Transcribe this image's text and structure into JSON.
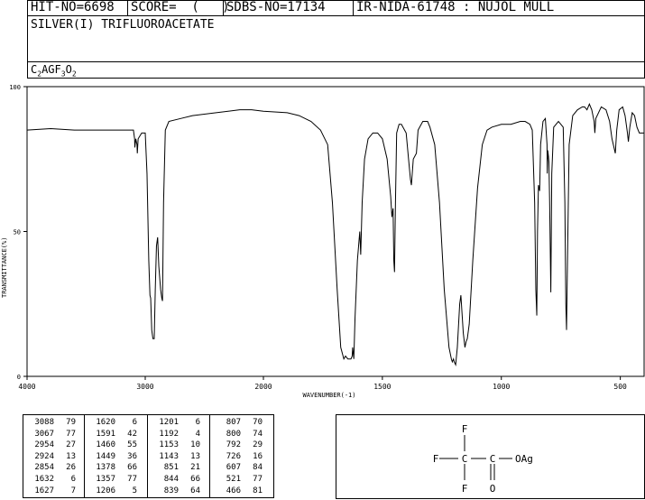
{
  "header": {
    "hit_no": "HIT-NO=6698",
    "score": "SCORE=  (   )",
    "sdbs_no": "SDBS-NO=17134",
    "ir_nida": "IR-NIDA-61748 : NUJOL MULL"
  },
  "compound": {
    "name": "SILVER(I) TRIFLUOROACETATE",
    "formula_parts": [
      "C",
      "2",
      "AGF",
      "3",
      "O",
      "2"
    ]
  },
  "chart_data": {
    "type": "line",
    "xlabel": "WAVENUMBER(-1)",
    "ylabel": "TRANSMITTANCE(%)",
    "xlim": [
      4000,
      400
    ],
    "ylim": [
      0,
      100
    ],
    "x_ticks": [
      "4000",
      "3000",
      "2000",
      "1500",
      "1000",
      "500"
    ],
    "y_ticks": [
      "100",
      "50",
      "0"
    ],
    "x_reverse": true,
    "grid": false,
    "spectrum": [
      [
        4000,
        85
      ],
      [
        3800,
        85.5
      ],
      [
        3600,
        85
      ],
      [
        3400,
        85
      ],
      [
        3200,
        85
      ],
      [
        3100,
        85
      ],
      [
        3090,
        82
      ],
      [
        3088,
        79
      ],
      [
        3080,
        82
      ],
      [
        3070,
        80
      ],
      [
        3067,
        77
      ],
      [
        3060,
        82
      ],
      [
        3030,
        84
      ],
      [
        3000,
        84
      ],
      [
        2985,
        70
      ],
      [
        2970,
        40
      ],
      [
        2960,
        28
      ],
      [
        2954,
        27
      ],
      [
        2945,
        16
      ],
      [
        2935,
        13
      ],
      [
        2924,
        13
      ],
      [
        2915,
        30
      ],
      [
        2905,
        45
      ],
      [
        2895,
        48
      ],
      [
        2885,
        38
      ],
      [
        2870,
        30
      ],
      [
        2860,
        27
      ],
      [
        2854,
        26
      ],
      [
        2845,
        60
      ],
      [
        2830,
        85
      ],
      [
        2800,
        88
      ],
      [
        2700,
        89
      ],
      [
        2600,
        90
      ],
      [
        2400,
        91
      ],
      [
        2200,
        92
      ],
      [
        2100,
        92
      ],
      [
        2000,
        91.5
      ],
      [
        1900,
        91
      ],
      [
        1850,
        90
      ],
      [
        1800,
        88
      ],
      [
        1760,
        85
      ],
      [
        1730,
        80
      ],
      [
        1710,
        60
      ],
      [
        1690,
        30
      ],
      [
        1675,
        10
      ],
      [
        1662,
        6
      ],
      [
        1655,
        7
      ],
      [
        1645,
        6
      ],
      [
        1632,
        6
      ],
      [
        1627,
        7
      ],
      [
        1625,
        10
      ],
      [
        1620,
        6
      ],
      [
        1615,
        20
      ],
      [
        1605,
        40
      ],
      [
        1595,
        50
      ],
      [
        1591,
        42
      ],
      [
        1585,
        60
      ],
      [
        1575,
        75
      ],
      [
        1560,
        82
      ],
      [
        1540,
        84
      ],
      [
        1520,
        84
      ],
      [
        1500,
        82
      ],
      [
        1480,
        75
      ],
      [
        1465,
        62
      ],
      [
        1460,
        55
      ],
      [
        1455,
        58
      ],
      [
        1452,
        40
      ],
      [
        1449,
        36
      ],
      [
        1445,
        60
      ],
      [
        1440,
        84
      ],
      [
        1430,
        87
      ],
      [
        1420,
        87
      ],
      [
        1400,
        84
      ],
      [
        1390,
        75
      ],
      [
        1382,
        68
      ],
      [
        1378,
        66
      ],
      [
        1370,
        75
      ],
      [
        1357,
        77
      ],
      [
        1350,
        85
      ],
      [
        1330,
        88
      ],
      [
        1310,
        88
      ],
      [
        1300,
        86
      ],
      [
        1280,
        80
      ],
      [
        1260,
        60
      ],
      [
        1240,
        30
      ],
      [
        1220,
        10
      ],
      [
        1210,
        6
      ],
      [
        1206,
        5
      ],
      [
        1201,
        6
      ],
      [
        1198,
        5
      ],
      [
        1192,
        4
      ],
      [
        1185,
        10
      ],
      [
        1175,
        25
      ],
      [
        1170,
        28
      ],
      [
        1160,
        15
      ],
      [
        1153,
        10
      ],
      [
        1148,
        12
      ],
      [
        1143,
        13
      ],
      [
        1135,
        18
      ],
      [
        1120,
        40
      ],
      [
        1100,
        65
      ],
      [
        1080,
        80
      ],
      [
        1060,
        85
      ],
      [
        1040,
        86
      ],
      [
        1000,
        87
      ],
      [
        960,
        87
      ],
      [
        920,
        88
      ],
      [
        900,
        88
      ],
      [
        880,
        87
      ],
      [
        870,
        85
      ],
      [
        860,
        60
      ],
      [
        855,
        30
      ],
      [
        851,
        21
      ],
      [
        848,
        50
      ],
      [
        844,
        66
      ],
      [
        839,
        64
      ],
      [
        835,
        80
      ],
      [
        825,
        88
      ],
      [
        815,
        89
      ],
      [
        808,
        80
      ],
      [
        807,
        70
      ],
      [
        805,
        78
      ],
      [
        802,
        76
      ],
      [
        800,
        74
      ],
      [
        797,
        60
      ],
      [
        792,
        29
      ],
      [
        788,
        70
      ],
      [
        780,
        86
      ],
      [
        760,
        88
      ],
      [
        750,
        87
      ],
      [
        740,
        86
      ],
      [
        733,
        60
      ],
      [
        729,
        25
      ],
      [
        726,
        16
      ],
      [
        722,
        40
      ],
      [
        715,
        80
      ],
      [
        700,
        90
      ],
      [
        680,
        92
      ],
      [
        660,
        93
      ],
      [
        650,
        93
      ],
      [
        640,
        92
      ],
      [
        630,
        94
      ],
      [
        620,
        92
      ],
      [
        610,
        88
      ],
      [
        607,
        84
      ],
      [
        603,
        89
      ],
      [
        580,
        93
      ],
      [
        560,
        92
      ],
      [
        545,
        88
      ],
      [
        535,
        82
      ],
      [
        521,
        77
      ],
      [
        515,
        85
      ],
      [
        505,
        92
      ],
      [
        490,
        93
      ],
      [
        480,
        90
      ],
      [
        470,
        84
      ],
      [
        466,
        81
      ],
      [
        460,
        86
      ],
      [
        450,
        91
      ],
      [
        440,
        90
      ],
      [
        430,
        86
      ],
      [
        420,
        84
      ],
      [
        400,
        84
      ]
    ]
  },
  "peak_table": {
    "columns": [
      [
        [
          "3088",
          "79"
        ],
        [
          "3067",
          "77"
        ],
        [
          "2954",
          "27"
        ],
        [
          "2924",
          "13"
        ],
        [
          "2854",
          "26"
        ],
        [
          "1632",
          "6"
        ],
        [
          "1627",
          "7"
        ]
      ],
      [
        [
          "1620",
          "6"
        ],
        [
          "1591",
          "42"
        ],
        [
          "1460",
          "55"
        ],
        [
          "1449",
          "36"
        ],
        [
          "1378",
          "66"
        ],
        [
          "1357",
          "77"
        ],
        [
          "1206",
          "5"
        ]
      ],
      [
        [
          "1201",
          "6"
        ],
        [
          "1192",
          "4"
        ],
        [
          "1153",
          "10"
        ],
        [
          "1143",
          "13"
        ],
        [
          "851",
          "21"
        ],
        [
          "844",
          "66"
        ],
        [
          "839",
          "64"
        ]
      ],
      [
        [
          "807",
          "70"
        ],
        [
          "800",
          "74"
        ],
        [
          "792",
          "29"
        ],
        [
          "726",
          "16"
        ],
        [
          "607",
          "84"
        ],
        [
          "521",
          "77"
        ],
        [
          "466",
          "81"
        ]
      ]
    ]
  },
  "structure": {
    "atoms": [
      "F",
      "F",
      "F",
      "C",
      "C",
      "O",
      "OAg"
    ]
  }
}
